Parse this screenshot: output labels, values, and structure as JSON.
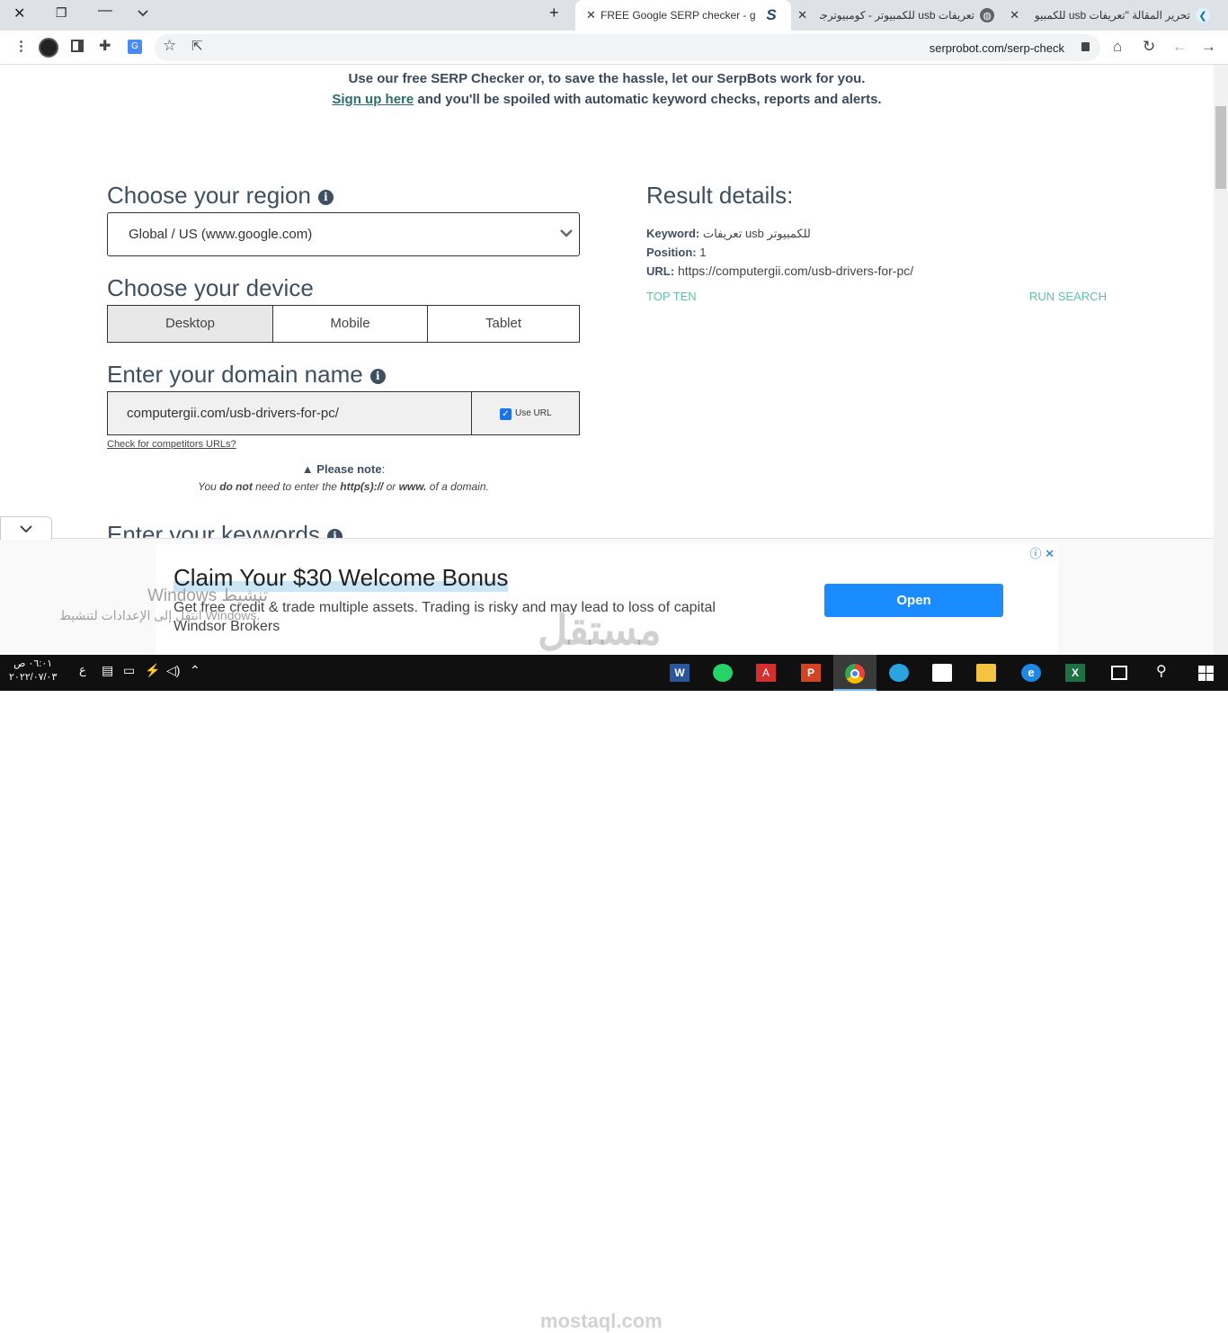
{
  "browser": {
    "tabs": [
      {
        "title": "تحرير المقالة \"تعريفات usb للكمبيو",
        "favicon": "wordpress-icon"
      },
      {
        "title": "تعريفات usb للكمبيوتر - كومبيوترجي",
        "favicon": "globe-icon"
      },
      {
        "title": "FREE Google SERP checker - goo",
        "favicon": "serprobot-icon"
      }
    ],
    "url": "serprobot.com/serp-check"
  },
  "intro": {
    "line1": "Use our free SERP Checker or, to save the hassle, let our SerpBots work for you.",
    "signup_link": "Sign up here",
    "line2_rest": "and you'll be spoiled with automatic keyword checks, reports and alerts."
  },
  "form": {
    "region_heading": "Choose your region",
    "region_value": "Global / US (www.google.com)",
    "device_heading": "Choose your device",
    "devices": [
      "Desktop",
      "Mobile",
      "Tablet"
    ],
    "selected_device": "Desktop",
    "domain_heading": "Enter your domain name",
    "domain_value": "computergii.com/usb-drivers-for-pc/",
    "use_url_label": "Use URL",
    "use_url_checked": true,
    "competitors_link": "Check for competitors URLs?",
    "note_title": "Please note",
    "note_parts": [
      "You ",
      "do not",
      " need to enter the ",
      "http(s)://",
      " or ",
      "www.",
      " of a domain."
    ],
    "keywords_heading": "Enter your keywords"
  },
  "results": {
    "heading": "Result details:",
    "keyword_label": "Keyword:",
    "keyword_value": "تعريفات usb للكمبيوتر",
    "position_label": "Position:",
    "position_value": "1",
    "url_label": "URL:",
    "url_value": "https://computergii.com/usb-drivers-for-pc/",
    "top_ten": "TOP TEN",
    "run_search": "RUN SEARCH",
    "link_color": "#5dc3a8"
  },
  "ad": {
    "title": "Claim Your $30 Welcome Bonus",
    "description": "Get free credit & trade multiple assets. Trading is risky and may lead to loss of capital",
    "brand": "Windsor Brokers",
    "button": "Open"
  },
  "overlay": {
    "activation_title": "Windows تنشيط",
    "activation_sub": "انتقل إلى الإعدادات لتنشيط Windows.",
    "watermark_ar": "مستقل",
    "watermark_en": "mostaql.com"
  },
  "taskbar": {
    "time": "٠٦:٠١ ص",
    "date": "٢٠٢٢/٠٧/٠٣",
    "lang": "ع",
    "apps": [
      "word-icon",
      "whatsapp-icon",
      "acrobat-icon",
      "powerpoint-icon",
      "chrome-icon",
      "telegram-icon",
      "store-icon",
      "file-explorer-icon",
      "edge-icon",
      "excel-icon",
      "task-view-icon",
      "search-icon",
      "start-icon"
    ]
  }
}
